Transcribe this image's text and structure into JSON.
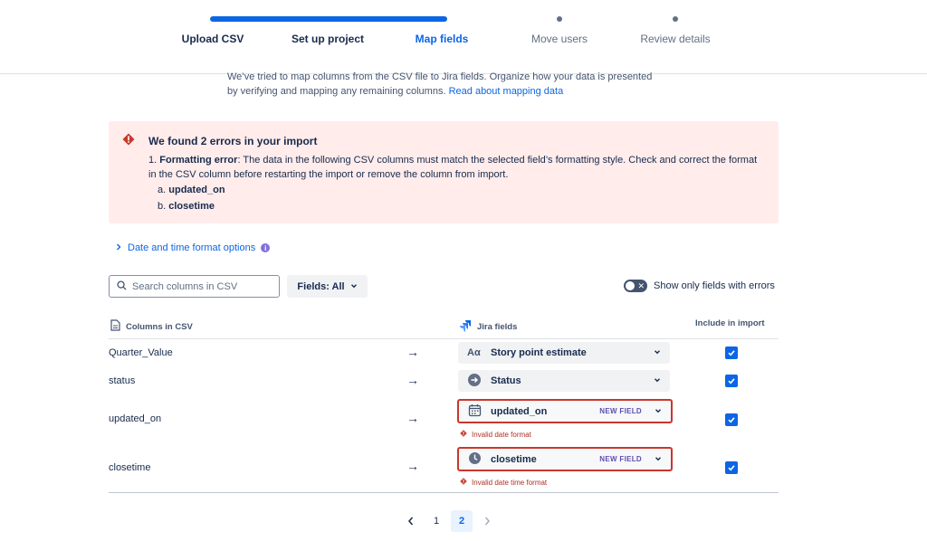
{
  "stepper": {
    "steps": [
      {
        "label": "Upload CSV",
        "state": "done"
      },
      {
        "label": "Set up project",
        "state": "done"
      },
      {
        "label": "Map fields",
        "state": "current"
      },
      {
        "label": "Move users",
        "state": "todo"
      },
      {
        "label": "Review details",
        "state": "todo"
      }
    ]
  },
  "intro": {
    "text": "We’ve tried to map columns from the CSV file to Jira fields. Organize how your data is presented by verifying and mapping any remaining columns.",
    "link": "Read about mapping data"
  },
  "error_banner": {
    "title": "We found 2 errors in your import",
    "item_number": "1.",
    "item_label": "Formatting error",
    "item_text": ": The data in the following CSV columns must match the selected field’s formatting style. Check and correct the format in the CSV column before restarting the import or remove the column from import.",
    "sub_items": [
      {
        "marker": "a.",
        "name": "updated_on"
      },
      {
        "marker": "b.",
        "name": "closetime"
      }
    ]
  },
  "format_options": {
    "label": "Date and time format options",
    "info": "i"
  },
  "toolbar": {
    "search_placeholder": "Search columns in CSV",
    "fields_label": "Fields: All",
    "toggle_label": "Show only fields with errors"
  },
  "table": {
    "headers": {
      "csv": "Columns in CSV",
      "jira": "Jira fields",
      "include": "Include in import"
    },
    "rows": [
      {
        "column": "Quarter_Value",
        "field": "Story point estimate",
        "icon": "text-icon",
        "new_field": "",
        "error": "",
        "included": true
      },
      {
        "column": "status",
        "field": "Status",
        "icon": "status-arrow-icon",
        "new_field": "",
        "error": "",
        "included": true
      },
      {
        "column": "updated_on",
        "field": "updated_on",
        "icon": "calendar-icon",
        "new_field": "NEW FIELD",
        "error": "Invalid date format",
        "included": true
      },
      {
        "column": "closetime",
        "field": "closetime",
        "icon": "clock-icon",
        "new_field": "NEW FIELD",
        "error": "Invalid date time format",
        "included": true
      }
    ]
  },
  "pagination": {
    "pages": [
      "1",
      "2"
    ],
    "current": "2"
  },
  "colors": {
    "accent": "#0c66e4",
    "error": "#c9372c",
    "error_bg": "#ffeceb",
    "new_field": "#5e4db2"
  }
}
